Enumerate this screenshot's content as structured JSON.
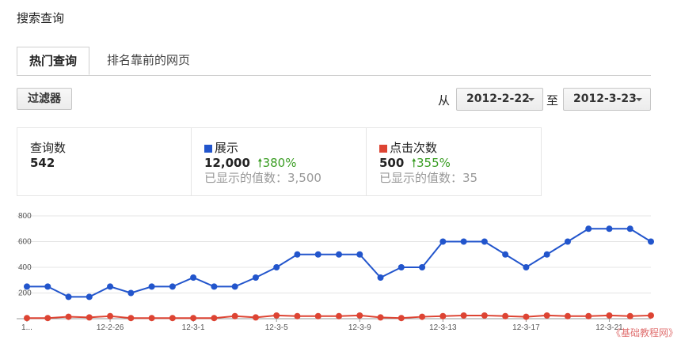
{
  "page": {
    "title": "搜索查询"
  },
  "tabs": [
    {
      "label": "热门查询",
      "active": true
    },
    {
      "label": "排名靠前的网页",
      "active": false
    }
  ],
  "toolbar": {
    "filter_label": "过滤器",
    "from_label": "从",
    "from_date": "2012-2-22",
    "to_label": "至",
    "to_date": "2012-3-23"
  },
  "metrics": [
    {
      "name": "查询数",
      "value": "542",
      "change": "",
      "sub": ""
    },
    {
      "name": "展示",
      "value": "12,000",
      "change": "380%",
      "sub": "已显示的值数：3,500"
    },
    {
      "name": "点击次数",
      "value": "500",
      "change": "355%",
      "sub": "已显示的值数：35"
    }
  ],
  "colors": {
    "impressions": "#2255cc",
    "clicks": "#dd4433",
    "increase": "#3a9d23"
  },
  "chart_data": {
    "type": "line",
    "ylim": [
      0,
      800
    ],
    "y_ticks": [
      200,
      400,
      600,
      800
    ],
    "x": [
      "2012-2-22",
      "2012-2-23",
      "2012-2-24",
      "2012-2-25",
      "2012-2-26",
      "2012-2-27",
      "2012-2-28",
      "2012-2-29",
      "2012-3-1",
      "2012-3-2",
      "2012-3-3",
      "2012-3-4",
      "2012-3-5",
      "2012-3-6",
      "2012-3-7",
      "2012-3-8",
      "2012-3-9",
      "2012-3-10",
      "2012-3-11",
      "2012-3-12",
      "2012-3-13",
      "2012-3-14",
      "2012-3-15",
      "2012-3-16",
      "2012-3-17",
      "2012-3-18",
      "2012-3-19",
      "2012-3-20",
      "2012-3-21",
      "2012-3-22",
      "2012-3-23"
    ],
    "x_tick_labels": [
      {
        "index": 0,
        "label": "1..."
      },
      {
        "index": 4,
        "label": "12-2-26"
      },
      {
        "index": 8,
        "label": "12-3-1"
      },
      {
        "index": 12,
        "label": "12-3-5"
      },
      {
        "index": 16,
        "label": "12-3-9"
      },
      {
        "index": 20,
        "label": "12-3-13"
      },
      {
        "index": 24,
        "label": "12-3-17"
      },
      {
        "index": 28,
        "label": "12-3-21"
      }
    ],
    "series": [
      {
        "values": [
          250,
          250,
          170,
          170,
          250,
          200,
          250,
          250,
          320,
          250,
          250,
          320,
          400,
          500,
          500,
          500,
          500,
          320,
          400,
          400,
          600,
          600,
          600,
          500,
          400,
          500,
          600,
          700,
          700,
          700,
          600
        ]
      },
      {
        "values": [
          5,
          5,
          15,
          10,
          20,
          5,
          5,
          5,
          5,
          5,
          20,
          10,
          25,
          20,
          20,
          20,
          25,
          10,
          5,
          15,
          20,
          25,
          25,
          20,
          15,
          25,
          20,
          20,
          25,
          20,
          25
        ]
      }
    ]
  },
  "watermark": "《基础教程网》"
}
